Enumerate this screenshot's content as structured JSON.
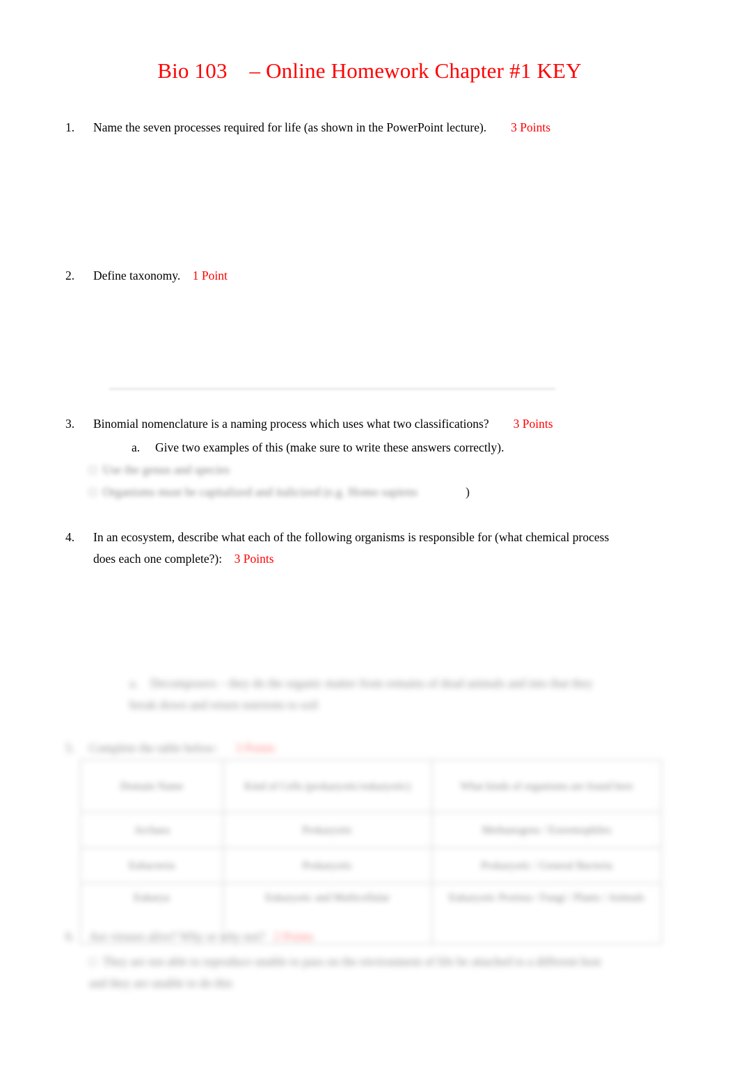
{
  "document": {
    "title": "Bio 103    – Online Homework Chapter #1 KEY",
    "title_color": "#ff0000",
    "body_color": "#000000",
    "points_color": "#ff0000"
  },
  "questions": [
    {
      "number": "1.",
      "text": "Name the   seven  processes required for life (as shown in the PowerPoint lecture).",
      "points": "3 Points"
    },
    {
      "number": "2.",
      "text": "Define taxonomy.",
      "points": "1 Point"
    },
    {
      "number": "3.",
      "text": "Binomial nomenclature is a naming process which uses what two classifications?",
      "points": "3 Points",
      "sub": [
        {
          "letter": "a.",
          "text": "Give two examples of this (make sure to write these answers correctly)."
        }
      ],
      "answers_redacted": [
        "Use the genus and species",
        "Organisms must be capitalized and italicized (e.g.   Homo sapiens"
      ],
      "trailing_char": ")"
    },
    {
      "number": "4.",
      "text": "In an ecosystem, describe what each of the following organisms is responsible for (what chemical process does each one complete?):",
      "points": "3 Points",
      "sub_redacted": [
        {
          "letter": "a.",
          "text": "Decomposers – they do the organic matter from remains of dead animals and into that they break down and return nutrients to soil"
        }
      ]
    },
    {
      "number": "5.",
      "text_redacted": "Complete the table below:",
      "points_redacted": "3 Points"
    },
    {
      "number": "6.",
      "text_redacted": "Are viruses  alive?  Why or why not?",
      "points_redacted": "2 Points",
      "answers_redacted": [
        "They are not able to reproduce unable to pass on the environment of life be attached to a different host and they are unable to do this"
      ]
    }
  ],
  "table": {
    "columns": 3,
    "headers": [
      "Domain Name",
      "Kind of Cells (prokaryotic/eukaryotic)",
      "What kinds of organisms are found here"
    ],
    "rows": [
      [
        "Archaea",
        "Prokaryotic",
        "Methanogens / Extremophiles"
      ],
      [
        "Eubacteria",
        "Prokaryotic",
        "Prokaryotic / General Bacteria"
      ],
      [
        "Eukarya",
        "Eukaryotic and Multicellular",
        "Eukaryotic Protista / Fungi / Plants / Animals"
      ]
    ]
  },
  "rule": {
    "present": true
  }
}
